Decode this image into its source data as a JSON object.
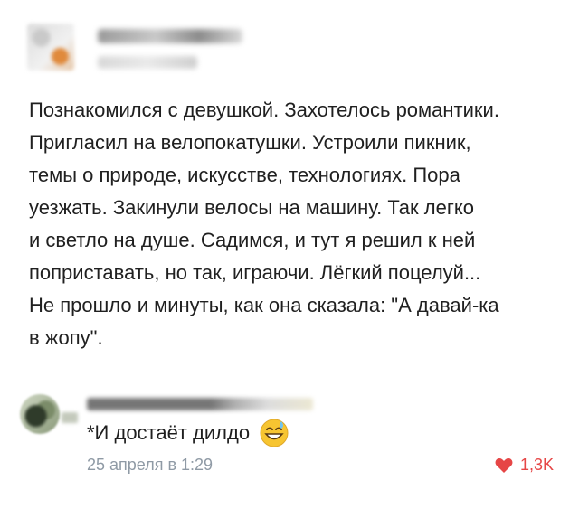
{
  "post": {
    "lines": [
      "Познакомился с девушкой. Захотелось романтики.",
      "Пригласил на велопокатушки. Устроили пикник,",
      "темы о природе, искусстве, технологиях. Пора",
      "уезжать. Закинули велосы на машину. Так легко",
      "и светло на душе. Садимся, и тут я решил к ней",
      "поприставать, но так, играючи. Лёгкий поцелуй...",
      "Не прошло и минуты, как она сказала: \"А давай-ка",
      "в жопу\"."
    ]
  },
  "comment": {
    "text": "*И достаёт дилдо",
    "emoji": "sweat-smile-emoji",
    "date": "25 апреля в 1:29",
    "likes": "1,3K"
  },
  "colors": {
    "like_red": "#e64646",
    "meta_gray": "#8f9aa5"
  }
}
